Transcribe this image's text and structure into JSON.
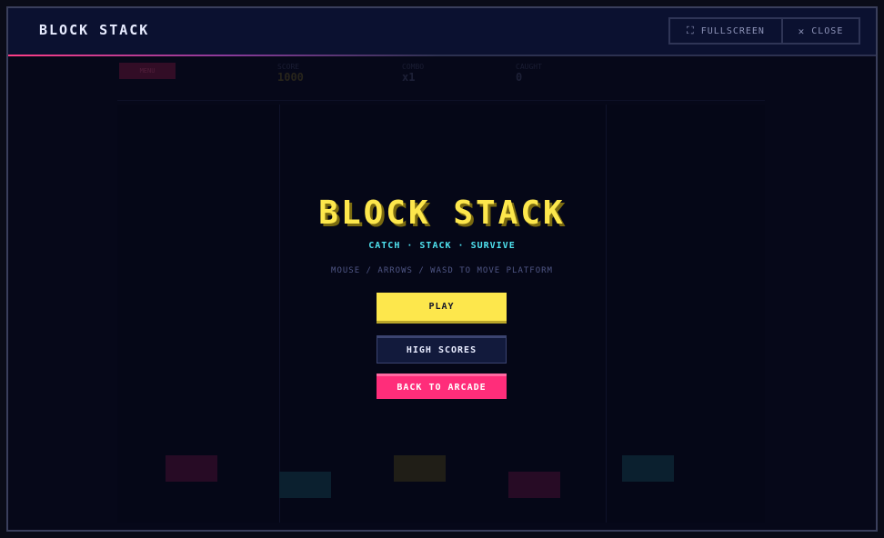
{
  "window": {
    "title": "BLOCK STACK",
    "fullscreen_label": "FULLSCREEN",
    "close_label": "CLOSE"
  },
  "hud": {
    "menu_label": "MENU",
    "score_label": "SCORE",
    "score_value": "1000",
    "combo_label": "COMBO",
    "combo_value": "x1",
    "caught_label": "CAUGHT",
    "caught_value": "0"
  },
  "menu": {
    "title": "BLOCK STACK",
    "tagline": "CATCH · STACK · SURVIVE",
    "hint": "MOUSE / ARROWS / WASD TO MOVE PLATFORM",
    "play_label": "PLAY",
    "high_scores_label": "HIGH SCORES",
    "back_label": "BACK TO ARCADE"
  },
  "colors": {
    "accent_yellow": "#fde74c",
    "accent_cyan": "#4fe3f0",
    "accent_pink": "#ff2d7a",
    "background": "#070a1c"
  },
  "icons": {
    "fullscreen": "fullscreen-icon",
    "close": "close-icon"
  }
}
